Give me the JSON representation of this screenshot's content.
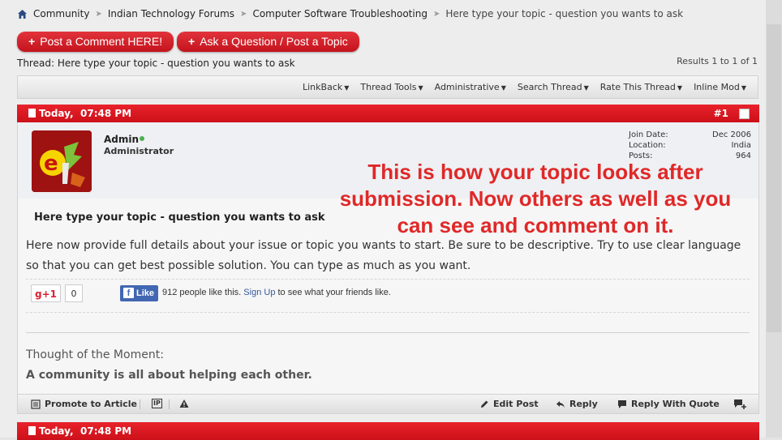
{
  "breadcrumb": {
    "items": [
      "Community",
      "Indian Technology Forums",
      "Computer Software Troubleshooting"
    ],
    "current": "Here type your topic - question you wants to ask"
  },
  "buttons": {
    "post_comment": "Post a Comment HERE!",
    "ask_question": "Ask a Question / Post a Topic"
  },
  "thread": {
    "label": "Thread:",
    "title": "Here type your topic - question you wants to ask",
    "results": "Results 1 to 1 of 1"
  },
  "toolbar": {
    "items": [
      "LinkBack",
      "Thread Tools",
      "Administrative",
      "Search Thread",
      "Rate This Thread",
      "Inline Mod"
    ]
  },
  "post": {
    "date": "Today,",
    "time": "07:48 PM",
    "number": "#1",
    "user": {
      "name": "Admin",
      "title": "Administrator",
      "join_label": "Join Date:",
      "join_value": "Dec 2006",
      "location_label": "Location:",
      "location_value": "India",
      "posts_label": "Posts:",
      "posts_value": "964"
    },
    "title": "Here type your topic - question you wants to ask",
    "text": "Here now provide full details about your issue or topic you wants to start. Be sure to be descriptive. Try to use clear language so that you can get best possible solution. You can type as much as you want.",
    "overlay": "This is how your topic looks after submission. Now others as well as you can see and comment on it.",
    "social": {
      "gplus": "g+1",
      "gplus_count": "0",
      "fb_like": "Like",
      "fb_text": "912 people like this.",
      "fb_signup": "Sign Up",
      "fb_text_end": "to see what your friends like."
    },
    "thought_label": "Thought of the Moment:",
    "thought_text": "A community is all about helping each other.",
    "footer": {
      "promote": "Promote to Article",
      "ip": "IP",
      "edit": "Edit Post",
      "reply": "Reply",
      "reply_quote": "Reply With Quote"
    }
  },
  "next_post": {
    "date": "Today,",
    "time": "07:48 PM"
  },
  "colors": {
    "accent_red": "#d4151e",
    "overlay_red": "#e02828",
    "facebook_blue": "#4267b2"
  }
}
